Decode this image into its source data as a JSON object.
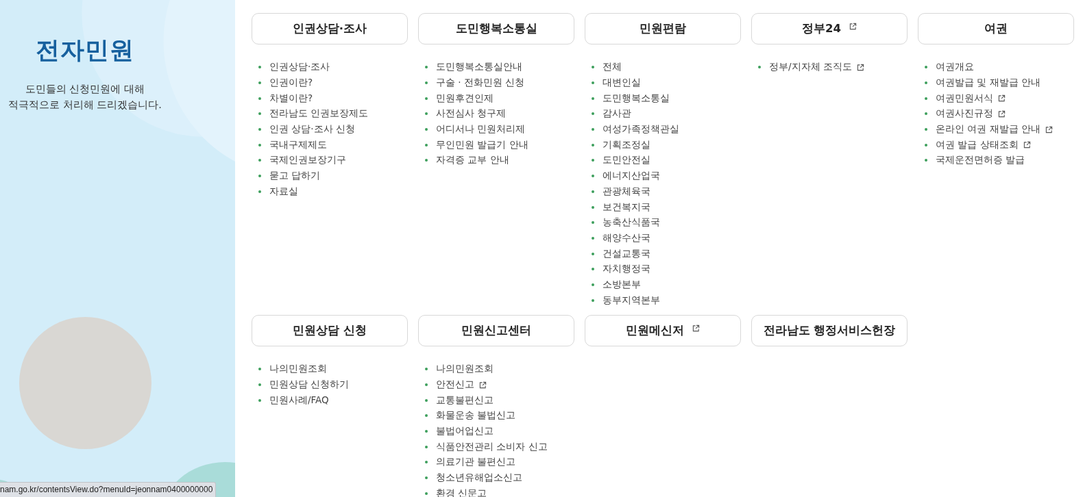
{
  "sidebar": {
    "title": "전자민원",
    "description": "도민들의 신청민원에 대해 적극적으로 처리해 드리겠습니다."
  },
  "sections": [
    {
      "title": "인권상담·조사",
      "external": false,
      "items": [
        {
          "label": "인권상담·조사",
          "external": false
        },
        {
          "label": "인권이란?",
          "external": false
        },
        {
          "label": "차별이란?",
          "external": false
        },
        {
          "label": "전라남도 인권보장제도",
          "external": false
        },
        {
          "label": "인권 상담·조사 신청",
          "external": false
        },
        {
          "label": "국내구제제도",
          "external": false
        },
        {
          "label": "국제인권보장기구",
          "external": false
        },
        {
          "label": "묻고 답하기",
          "external": false
        },
        {
          "label": "자료실",
          "external": false
        }
      ]
    },
    {
      "title": "도민행복소통실",
      "external": false,
      "items": [
        {
          "label": "도민행복소통실안내",
          "external": false
        },
        {
          "label": "구술 · 전화민원 신청",
          "external": false
        },
        {
          "label": "민원후견인제",
          "external": false
        },
        {
          "label": "사전심사 청구제",
          "external": false
        },
        {
          "label": "어디서나 민원처리제",
          "external": false
        },
        {
          "label": "무인민원 발급기 안내",
          "external": false
        },
        {
          "label": "자격증 교부 안내",
          "external": false
        }
      ]
    },
    {
      "title": "민원편람",
      "external": false,
      "items": [
        {
          "label": "전체",
          "external": false
        },
        {
          "label": "대변인실",
          "external": false
        },
        {
          "label": "도민행복소통실",
          "external": false
        },
        {
          "label": "감사관",
          "external": false
        },
        {
          "label": "여성가족정책관실",
          "external": false
        },
        {
          "label": "기획조정실",
          "external": false
        },
        {
          "label": "도민안전실",
          "external": false
        },
        {
          "label": "에너지산업국",
          "external": false
        },
        {
          "label": "관광체육국",
          "external": false
        },
        {
          "label": "보건복지국",
          "external": false
        },
        {
          "label": "농축산식품국",
          "external": false
        },
        {
          "label": "해양수산국",
          "external": false
        },
        {
          "label": "건설교통국",
          "external": false
        },
        {
          "label": "자치행정국",
          "external": false
        },
        {
          "label": "소방본부",
          "external": false
        },
        {
          "label": "동부지역본부",
          "external": false
        }
      ]
    },
    {
      "title": "정부24",
      "external": true,
      "items": [
        {
          "label": "정부/지자체 조직도",
          "external": true
        }
      ]
    },
    {
      "title": "여권",
      "external": false,
      "items": [
        {
          "label": "여권개요",
          "external": false
        },
        {
          "label": "여권발급 및 재발급 안내",
          "external": false
        },
        {
          "label": "여권민원서식",
          "external": true
        },
        {
          "label": "여권사진규정",
          "external": true
        },
        {
          "label": "온라인 여권 재발급 안내",
          "external": true
        },
        {
          "label": "여권 발급 상태조회",
          "external": true
        },
        {
          "label": "국제운전면허증 발급",
          "external": false
        }
      ]
    },
    {
      "title": "민원상담 신청",
      "external": false,
      "items": [
        {
          "label": "나의민원조회",
          "external": false
        },
        {
          "label": "민원상담 신청하기",
          "external": false
        },
        {
          "label": "민원사례/FAQ",
          "external": false
        }
      ]
    },
    {
      "title": "민원신고센터",
      "external": false,
      "items": [
        {
          "label": "나의민원조회",
          "external": false
        },
        {
          "label": "안전신고",
          "external": true
        },
        {
          "label": "교통불편신고",
          "external": false
        },
        {
          "label": "화물운송 불법신고",
          "external": false
        },
        {
          "label": "불법어업신고",
          "external": false
        },
        {
          "label": "식품안전관리 소비자 신고",
          "external": false
        },
        {
          "label": "의료기관 불편신고",
          "external": false
        },
        {
          "label": "청소년유해업소신고",
          "external": false
        },
        {
          "label": "환경 신문고",
          "external": false
        }
      ]
    },
    {
      "title": "민원메신저",
      "external": true
    },
    {
      "title": "전라남도 행정서비스헌장",
      "external": false
    }
  ],
  "status_bar": {
    "url": "nam.go.kr/contentsView.do?menuId=jeonnam0400000000"
  }
}
